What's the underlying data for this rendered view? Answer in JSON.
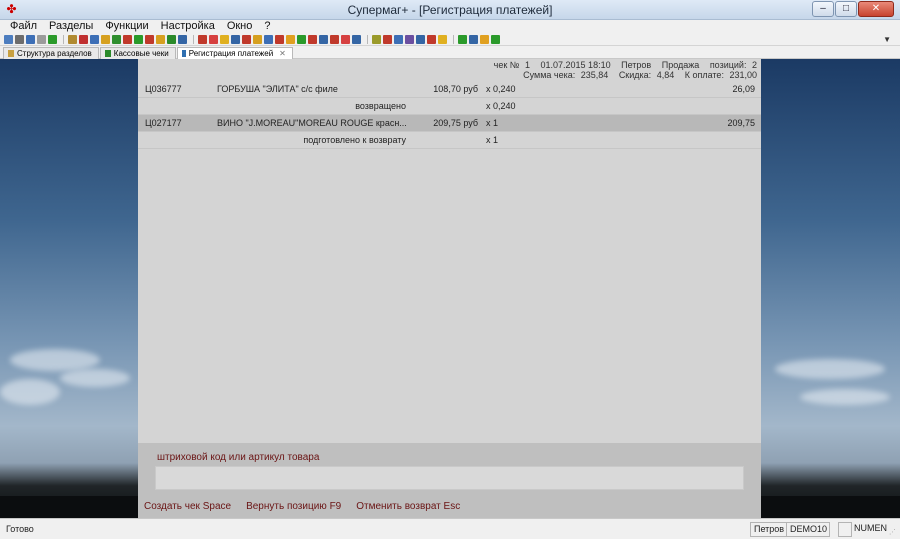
{
  "window": {
    "title": "Супермаг+  - [Регистрация платежей]",
    "buttons": {
      "minimize": "–",
      "maximize": "□",
      "close": "✕"
    }
  },
  "menu": [
    "Файл",
    "Разделы",
    "Функции",
    "Настройка",
    "Окно",
    "?"
  ],
  "toolbar": {
    "icon_colors": [
      "#4c7dbf",
      "#6c6c6c",
      "#3d6fb6",
      "#9b9b9b",
      "#2a9a2a",
      "#b08a30",
      "#c03030",
      "#3d6fb6",
      "#d6a020",
      "#2f8f2f",
      "#c0392b",
      "#2a9a2a",
      "#c0392b",
      "#d6a020",
      "#2a8a2a",
      "#3465a4",
      "#c0392b",
      "#d64040",
      "#e0b020",
      "#3465a4",
      "#c0392b",
      "#d6a020",
      "#3d6fb6",
      "#c0392b",
      "#e0a020",
      "#2a9a2a",
      "#c0392b",
      "#3465a4",
      "#c0392b",
      "#d64040",
      "#3465a4",
      "#9a9a2a",
      "#c0392b",
      "#3d6fb6",
      "#6b4fa0",
      "#3465a4",
      "#c0392b",
      "#e0b020",
      "#2a9a2a",
      "#3465a4",
      "#e0a020",
      "#2a9a2a"
    ]
  },
  "tabs": [
    {
      "label": "Структура разделов",
      "icon": "tree-icon",
      "active": false
    },
    {
      "label": "Кассовые чеки",
      "icon": "receipt-icon",
      "active": false
    },
    {
      "label": "Регистрация платежей",
      "icon": "payment-icon",
      "active": true,
      "close": "✕"
    }
  ],
  "receipt": {
    "check_label": "чек №",
    "check_no": "1",
    "datetime": "01.07.2015 18:10",
    "cashier": "Петров",
    "operation": "Продажа",
    "positions_label": "позиций:",
    "positions": "2",
    "sum_label": "Сумма чека:",
    "sum": "235,84",
    "discount_label": "Скидка:",
    "discount": "4,84",
    "to_pay_label": "К оплате:",
    "to_pay": "231,00"
  },
  "rows": [
    {
      "code": "Ц036777",
      "name": "ГОРБУША \"ЭЛИТА\" с/с филе",
      "price": "108,70 руб",
      "qty": "x 0,240",
      "sum": "26,09",
      "status": "возвращено",
      "status_qty": "x 0,240",
      "selected": false
    },
    {
      "code": "Ц027177",
      "name": "ВИНО \"J.MOREAU\"MOREAU ROUGE красн...",
      "price": "209,75 руб",
      "qty": "x 1",
      "sum": "209,75",
      "status": "подготовлено к возврату",
      "status_qty": "x 1",
      "selected": true
    }
  ],
  "input": {
    "label": "штриховой код или артикул товара",
    "value": ""
  },
  "actions": [
    "Создать чек Space",
    "Вернуть позицию F9",
    "Отменить возврат Esc"
  ],
  "statusbar": {
    "text": "Готово",
    "user": "Петров",
    "db": "DEMO10",
    "empty": "",
    "numlock": "NUMEN"
  }
}
